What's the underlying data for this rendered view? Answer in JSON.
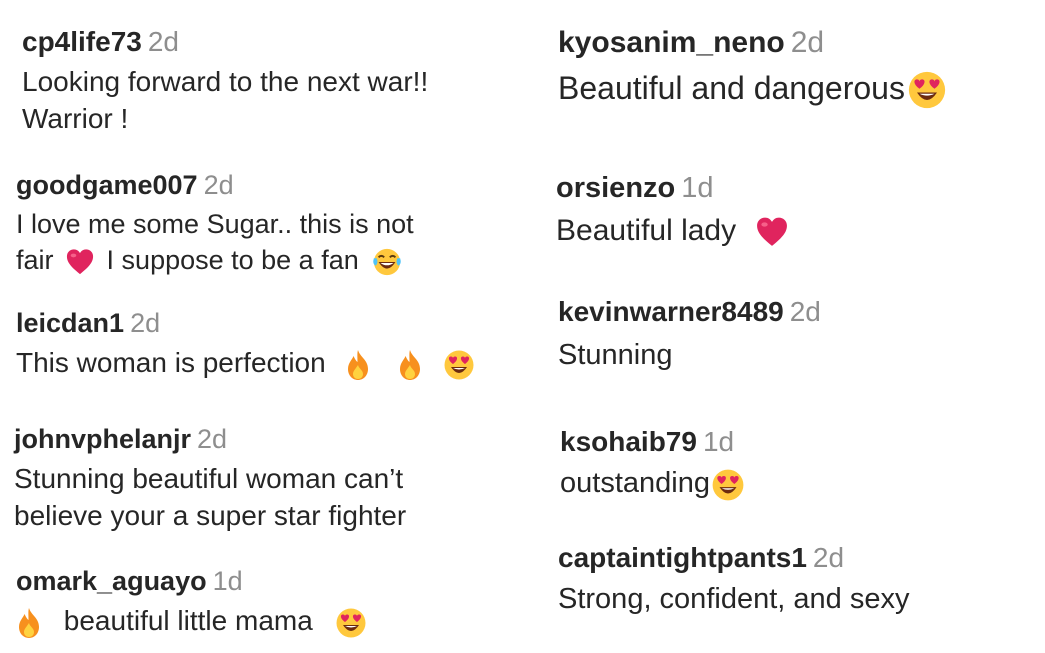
{
  "comments_left": [
    {
      "username": "cp4life73",
      "time": "2d",
      "text_parts": [
        "Looking forward to the next war!!",
        "Warrior !"
      ]
    },
    {
      "username": "goodgame007",
      "time": "2d",
      "text_parts": [
        "I love me some Sugar.. this is not",
        "fair",
        "I suppose to be a fan"
      ],
      "emojis": [
        "red-heart-icon",
        "laughing-tears-icon"
      ]
    },
    {
      "username": "leicdan1",
      "time": "2d",
      "text_parts": [
        "This woman is perfection"
      ],
      "emojis": [
        "fire-icon",
        "fire-icon",
        "heart-eyes-icon"
      ]
    },
    {
      "username": "johnvphelanjr",
      "time": "2d",
      "text_parts": [
        "Stunning beautiful woman can’t",
        "believe your a super star fighter"
      ]
    },
    {
      "username": "omark_aguayo",
      "time": "1d",
      "text_parts": [
        "beautiful little mama"
      ],
      "emojis": [
        "fire-icon",
        "heart-eyes-icon"
      ]
    }
  ],
  "comments_right": [
    {
      "username": "kyosanim_neno",
      "time": "2d",
      "text_parts": [
        "Beautiful and dangerous"
      ],
      "emojis": [
        "heart-eyes-icon"
      ]
    },
    {
      "username": "orsienzo",
      "time": "1d",
      "text_parts": [
        "Beautiful lady"
      ],
      "emojis": [
        "red-heart-icon"
      ]
    },
    {
      "username": "kevinwarner8489",
      "time": "2d",
      "text_parts": [
        "Stunning"
      ]
    },
    {
      "username": "ksohaib79",
      "time": "1d",
      "text_parts": [
        "outstanding"
      ],
      "emojis": [
        "heart-eyes-icon"
      ]
    },
    {
      "username": "captaintightpants1",
      "time": "2d",
      "text_parts": [
        "Strong, confident, and sexy"
      ]
    }
  ],
  "colors": {
    "username": "#262626",
    "timestamp": "#8e8e8e",
    "heart": "#e0245e",
    "emoji_face": "#ffc83d",
    "fire": "#f7901e"
  }
}
